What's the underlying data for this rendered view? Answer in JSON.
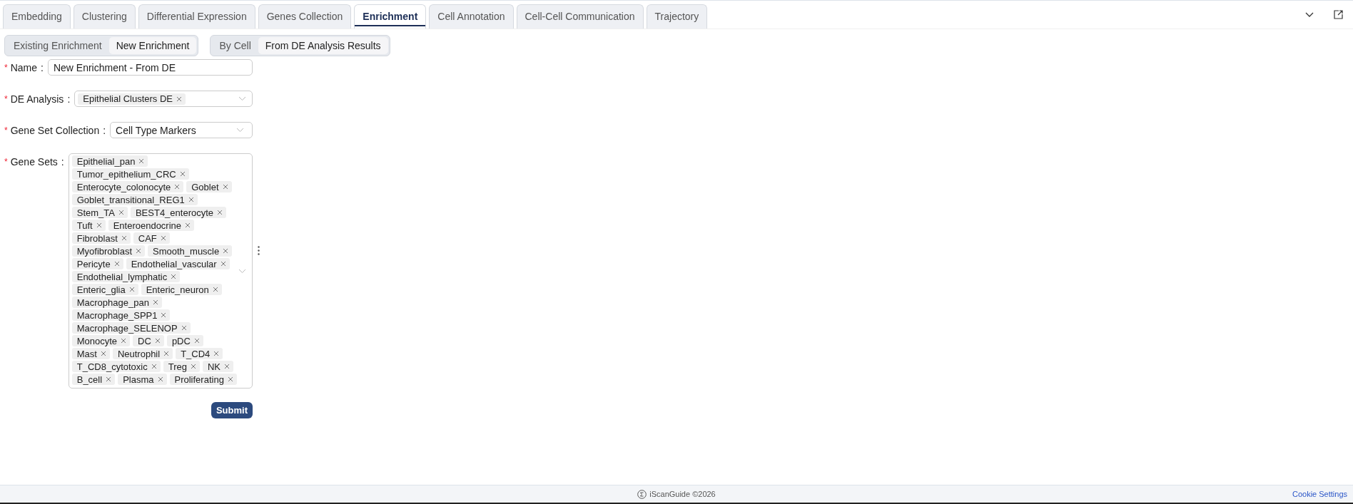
{
  "tabs": [
    {
      "label": "Embedding",
      "selected": false
    },
    {
      "label": "Clustering",
      "selected": false
    },
    {
      "label": "Differential Expression",
      "selected": false
    },
    {
      "label": "Genes Collection",
      "selected": false
    },
    {
      "label": "Enrichment",
      "selected": true
    },
    {
      "label": "Cell Annotation",
      "selected": false
    },
    {
      "label": "Cell-Cell Communication",
      "selected": false
    },
    {
      "label": "Trajectory",
      "selected": false
    }
  ],
  "mode_toggle": [
    {
      "label": "Existing Enrichment",
      "selected": false
    },
    {
      "label": "New Enrichment",
      "selected": true
    }
  ],
  "source_toggle": [
    {
      "label": "By Cell",
      "selected": false
    },
    {
      "label": "From DE Analysis Results",
      "selected": true
    }
  ],
  "form": {
    "fields": [
      {
        "kind": "text",
        "mark": "*",
        "label": "Name",
        "separator": ":",
        "value": "New Enrichment - From DE"
      },
      {
        "kind": "multiselect",
        "mark": "*",
        "label": "DE Analysis",
        "separator": ":",
        "tags": [
          "Epithelial Clusters DE"
        ]
      },
      {
        "kind": "select",
        "mark": "*",
        "label": "Gene Set Collection",
        "separator": ":",
        "value": "Cell Type Markers"
      },
      {
        "kind": "multiselect",
        "mark": "*",
        "label": "Gene Sets",
        "separator": ":",
        "tags": [
          "Epithelial_pan",
          "Tumor_epithelium_CRC",
          "Enterocyte_colonocyte",
          "Goblet",
          "Goblet_transitional_REG1",
          "Stem_TA",
          "BEST4_enterocyte",
          "Tuft",
          "Enteroendocrine",
          "Fibroblast",
          "CAF",
          "Myofibroblast",
          "Smooth_muscle",
          "Pericyte",
          "Endothelial_vascular",
          "Endothelial_lymphatic",
          "Enteric_glia",
          "Enteric_neuron",
          "Macrophage_pan",
          "Macrophage_SPP1",
          "Macrophage_SELENOP",
          "Monocyte",
          "DC",
          "pDC",
          "Mast",
          "Neutrophil",
          "T_CD4",
          "T_CD8_cytotoxic",
          "Treg",
          "NK",
          "B_cell",
          "Plasma",
          "Proliferating"
        ]
      }
    ],
    "submit": "Submit"
  },
  "footer": {
    "brand": "iScanGuide ©2026",
    "link": "Cookie Settings"
  }
}
